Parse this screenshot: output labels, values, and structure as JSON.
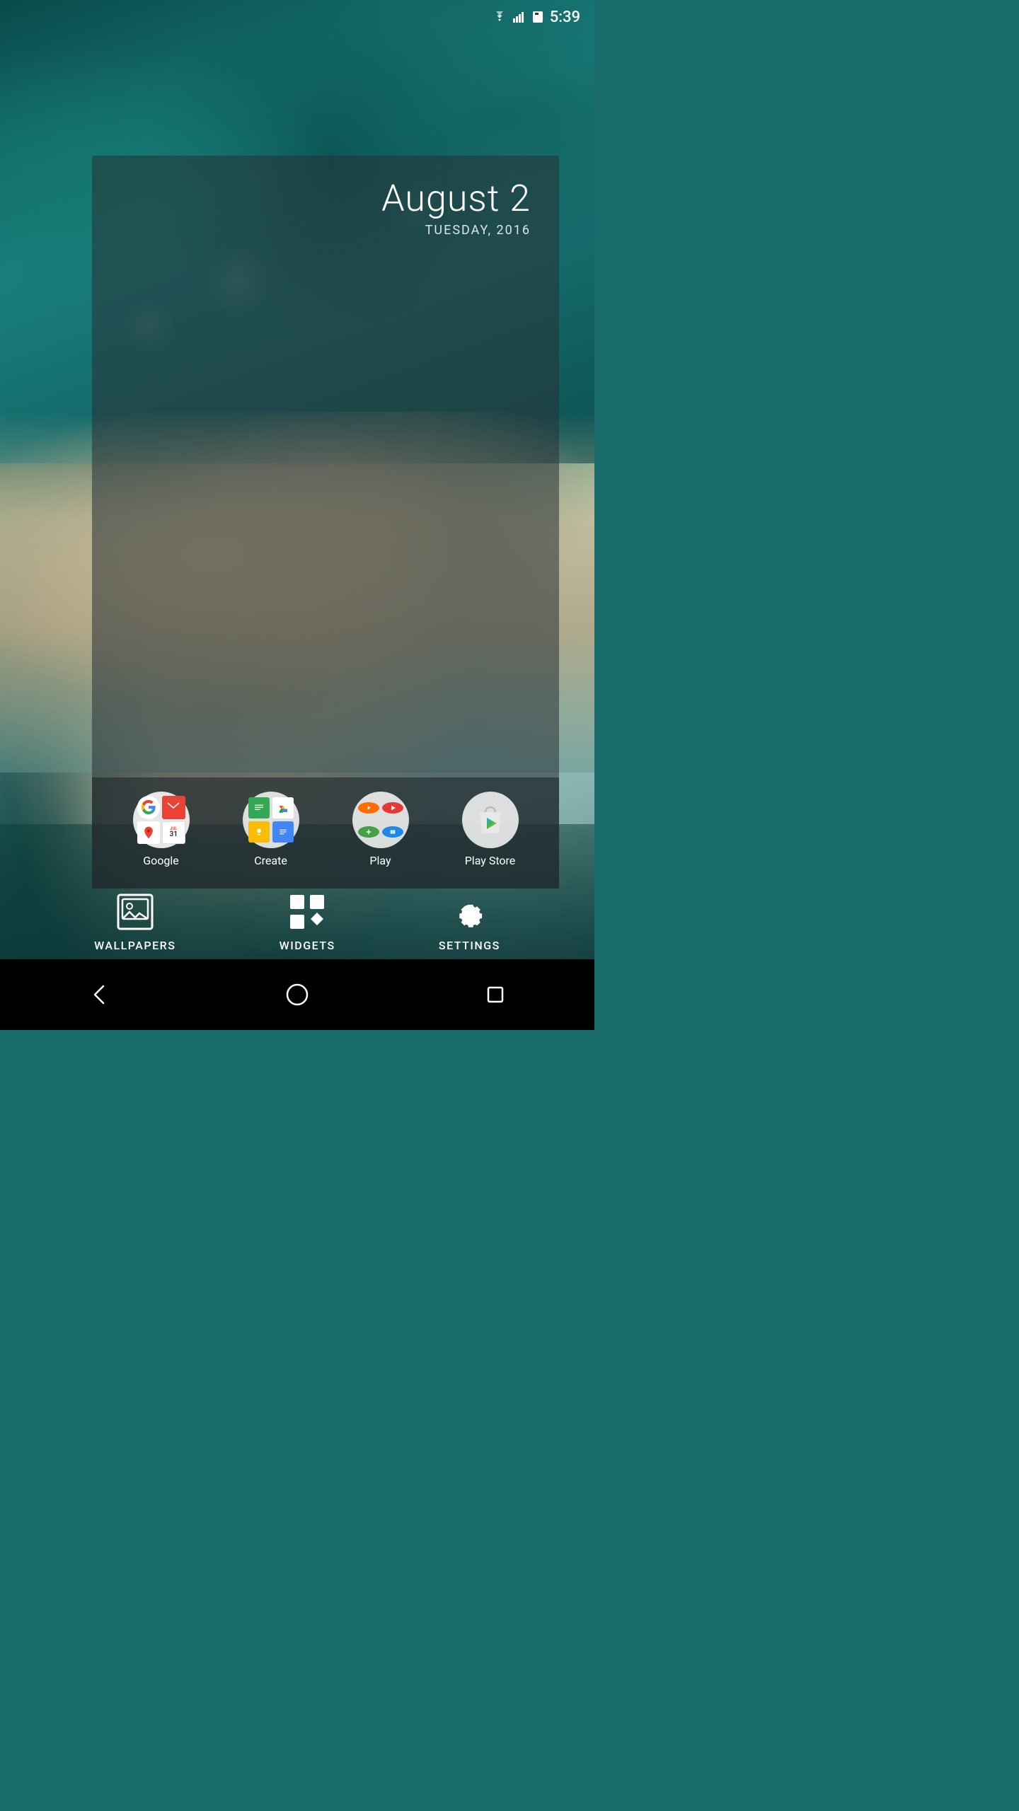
{
  "status_bar": {
    "time": "5:39"
  },
  "date_widget": {
    "date": "August 2",
    "day_year": "TUESDAY, 2016"
  },
  "apps": [
    {
      "id": "google",
      "label": "Google",
      "type": "folder"
    },
    {
      "id": "create",
      "label": "Create",
      "type": "folder"
    },
    {
      "id": "play",
      "label": "Play",
      "type": "folder"
    },
    {
      "id": "playstore",
      "label": "Play Store",
      "type": "single"
    }
  ],
  "bottom_bar": [
    {
      "id": "wallpapers",
      "label": "WALLPAPERS"
    },
    {
      "id": "widgets",
      "label": "WIDGETS"
    },
    {
      "id": "settings",
      "label": "SETTINGS"
    }
  ],
  "nav": {
    "back_label": "back",
    "home_label": "home",
    "recents_label": "recents"
  }
}
